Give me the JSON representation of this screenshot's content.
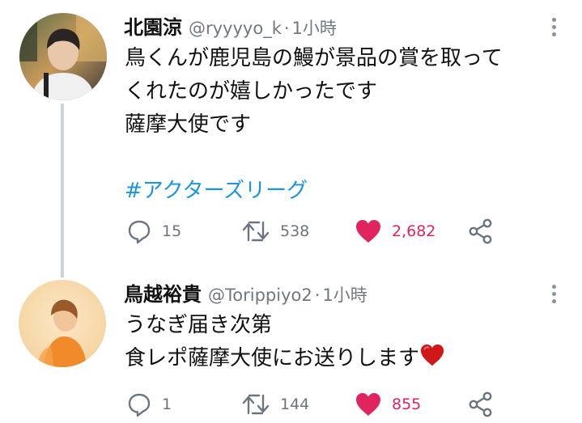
{
  "tweets": [
    {
      "name": "北園涼",
      "handle": "@ryyyyo_k",
      "separator": "·",
      "time": "1小時",
      "lines": [
        "鳥くんが鹿児島の鰻が景品の賞を取って",
        "くれたのが嬉しかったです",
        "薩摩大使です"
      ],
      "hashtag": "#アクターズリーグ",
      "replies": "15",
      "retweets": "538",
      "likes": "2,682"
    },
    {
      "name": "鳥越裕貴",
      "handle": "@Torippiyo2",
      "separator": "·",
      "time": "1小時",
      "lines": [
        "うなぎ届き次第",
        "食レポ薩摩大使にお送りします"
      ],
      "replies": "1",
      "retweets": "144",
      "likes": "855"
    }
  ],
  "colors": {
    "like": "#e0245e",
    "link": "#1b95e0",
    "meta": "#707880",
    "thread": "#cdd3d8"
  },
  "icons": [
    "reply-icon",
    "retweet-icon",
    "like-heart-icon",
    "share-icon",
    "more-vertical-icon",
    "red-heart-emoji"
  ]
}
